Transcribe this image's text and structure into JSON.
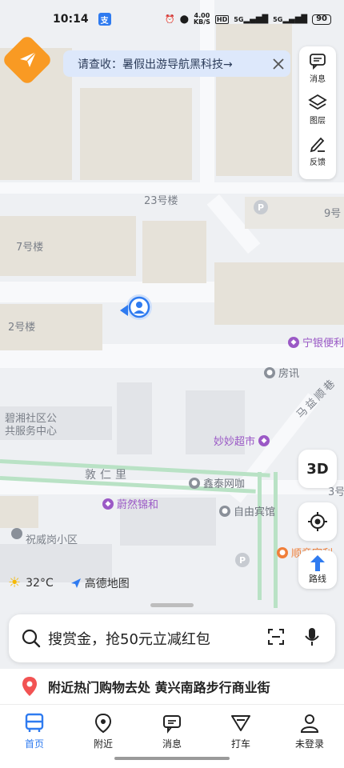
{
  "status_bar": {
    "time": "10:14",
    "app_badge": "支",
    "net_speed_value": "4.00",
    "net_speed_unit": "KB/S",
    "hd_label": "HD",
    "signal1": "5G",
    "signal2": "5G",
    "battery": "90"
  },
  "notice": {
    "text": "请查收：暑假出游导航黑科技→"
  },
  "tools": {
    "messages": "消息",
    "layers": "图层",
    "feedback": "反馈"
  },
  "map": {
    "buildings": [
      "23号楼",
      "9号",
      "7号楼",
      "2号楼",
      "3号"
    ],
    "community": [
      "碧湘社区公",
      "共服务中心"
    ],
    "road_name": "敦仁里",
    "road_name2": "马益顺巷",
    "district": "祝威岗小区",
    "pois": [
      {
        "name": "宁银便利",
        "color": "#9b59c6"
      },
      {
        "name": "房讯",
        "color": "#8a9099"
      },
      {
        "name": "妙妙超市",
        "color": "#9b59c6"
      },
      {
        "name": "鑫泰网咖",
        "color": "#8a9099"
      },
      {
        "name": "蔚然锦和",
        "color": "#9b59c6"
      },
      {
        "name": "自由宾馆",
        "color": "#8a9099"
      },
      {
        "name": "顺意宴利",
        "color": "#f07f3a"
      }
    ]
  },
  "controls": {
    "three_d": "3D",
    "route": "路线"
  },
  "weather": {
    "temperature": "32°C",
    "brand": "高德地图"
  },
  "search": {
    "placeholder": "搜赏金，抢50元立减红包"
  },
  "hot": {
    "text": "附近热门购物去处 黄兴南路步行商业街"
  },
  "tabs": [
    {
      "label": "首页",
      "icon": "bus-icon"
    },
    {
      "label": "附近",
      "icon": "location-pin-icon"
    },
    {
      "label": "消息",
      "icon": "message-icon"
    },
    {
      "label": "打车",
      "icon": "taxi-icon"
    },
    {
      "label": "未登录",
      "icon": "user-icon"
    }
  ],
  "colors": {
    "accent": "#2f7bf0",
    "brand_orange": "#f99a23"
  }
}
